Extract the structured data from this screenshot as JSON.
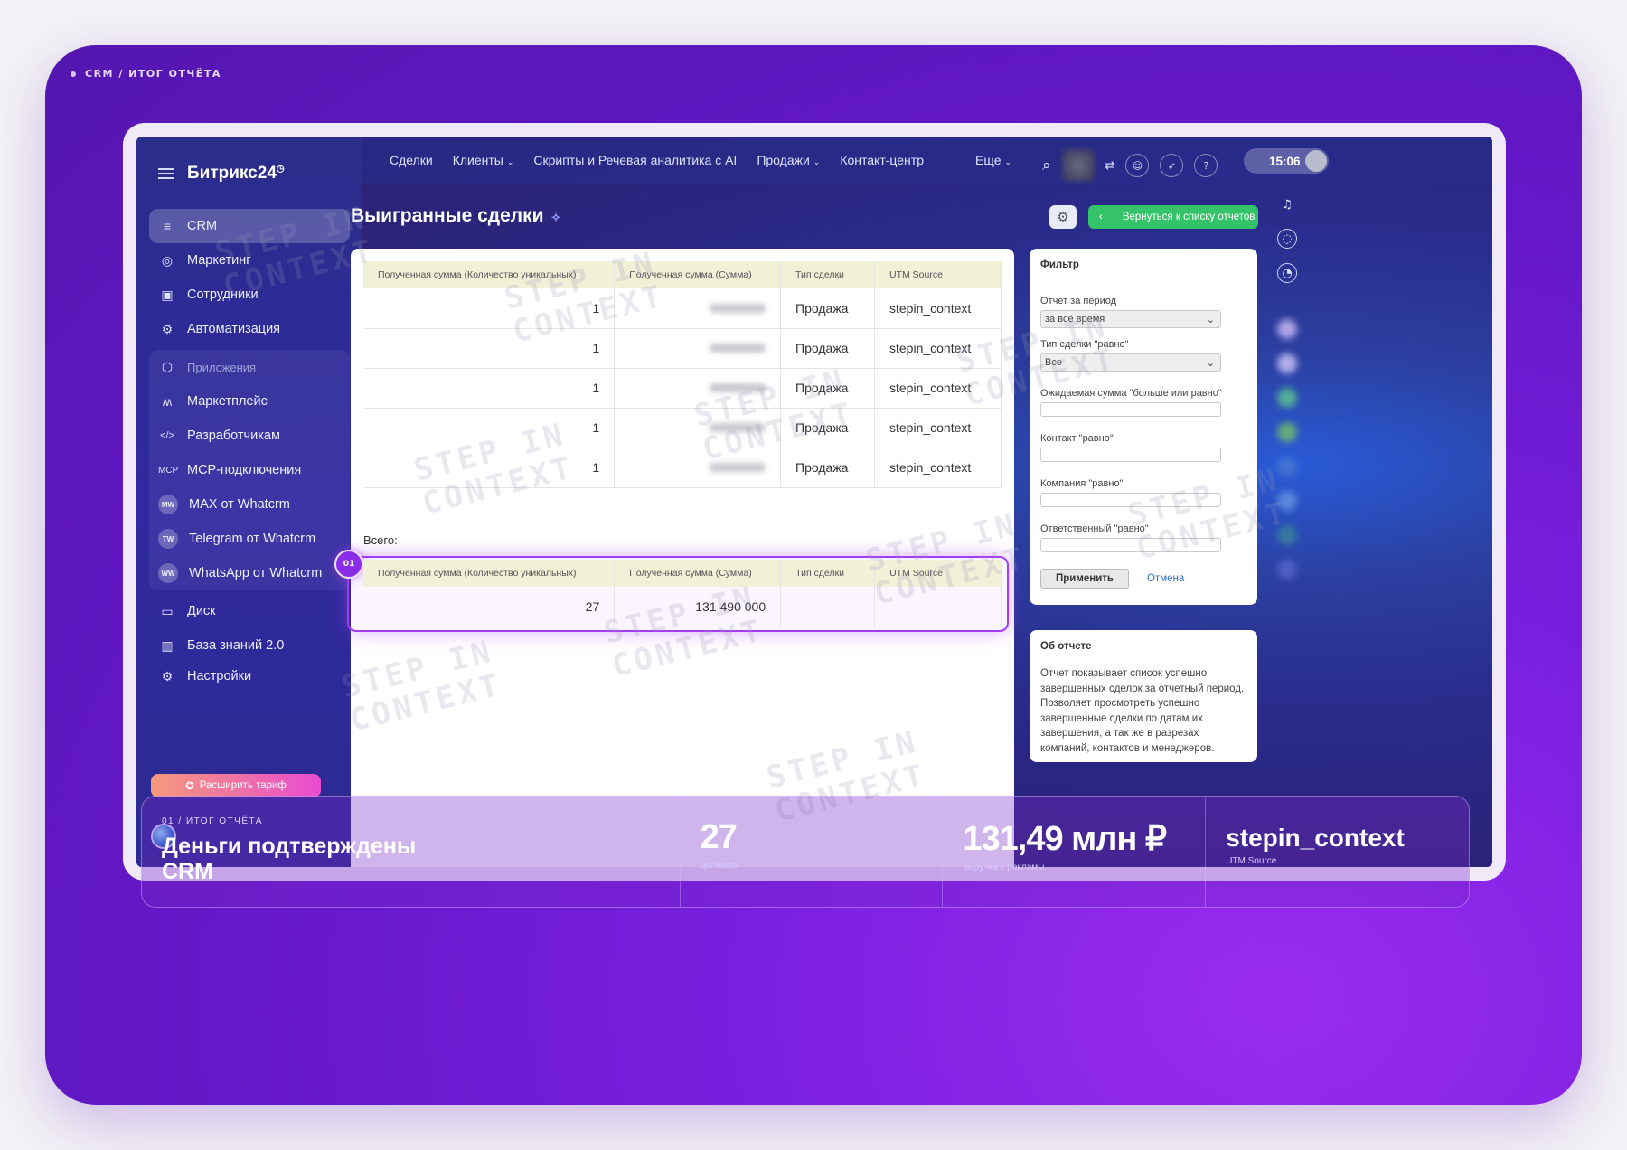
{
  "breadcrumb": "CRM / ИТОГ ОТЧЁТА",
  "app": {
    "logo": "Битрикс24",
    "logo_mark": "◷",
    "sidebar": [
      {
        "label": "CRM",
        "icon": "filter-icon",
        "glyph": "≡"
      },
      {
        "label": "Маркетинг",
        "icon": "target-icon",
        "glyph": "◎"
      },
      {
        "label": "Сотрудники",
        "icon": "id-card-icon",
        "glyph": "▣"
      },
      {
        "label": "Автоматизация",
        "icon": "robot-icon",
        "glyph": "⚙"
      }
    ],
    "apps_group": {
      "title": "Приложения",
      "items": [
        {
          "label": "Маркетплейс",
          "glyph": "ʍ"
        },
        {
          "label": "Разработчикам",
          "glyph": "</>"
        },
        {
          "label": "MCP-подключения",
          "glyph": "MCP"
        },
        {
          "label": "MAX от Whatcrm",
          "badge": "MW"
        },
        {
          "label": "Telegram от Whatcrm",
          "badge": "TW"
        },
        {
          "label": "WhatsApp от Whatcrm",
          "badge": "WW"
        }
      ]
    },
    "sidebar_bottom": [
      {
        "label": "Диск",
        "glyph": "▭"
      },
      {
        "label": "База знаний 2.0",
        "glyph": "▥"
      },
      {
        "label": "Настройки",
        "glyph": "⚙"
      }
    ],
    "upgrade": "Расширить тариф",
    "nav": [
      "Сделки",
      "Клиенты",
      "Скрипты и Речевая аналитика с AI",
      "Продажи",
      "Контакт-центр"
    ],
    "more": "Еще",
    "time": "15:06",
    "page_title": "Выигранные сделки",
    "back_button": "Вернуться к списку отчетов",
    "table": {
      "headers": [
        "Полученная сумма (Количество уникальных)",
        "Полученная сумма (Сумма)",
        "Тип сделки",
        "UTM Source"
      ],
      "rows": [
        [
          "1",
          "",
          "Продажа",
          "stepin_context"
        ],
        [
          "1",
          "",
          "Продажа",
          "stepin_context"
        ],
        [
          "1",
          "",
          "Продажа",
          "stepin_context"
        ],
        [
          "1",
          "",
          "Продажа",
          "stepin_context"
        ],
        [
          "1",
          "",
          "Продажа",
          "stepin_context"
        ]
      ]
    },
    "total_label": "Всего:",
    "total": {
      "headers": [
        "Полученная сумма (Количество уникальных)",
        "Полученная сумма (Сумма)",
        "Тип сделки",
        "UTM Source"
      ],
      "values": [
        "27",
        "131 490 000",
        "—",
        "—"
      ]
    },
    "marker": "01",
    "filter": {
      "title": "Фильтр",
      "period_label": "Отчет за период",
      "period_value": "за все время",
      "type_label": "Тип сделки \"равно\"",
      "type_value": "Все",
      "expected_label": "Ожидаемая сумма \"больше или равно\"",
      "contact_label": "Контакт \"равно\"",
      "company_label": "Компания \"равно\"",
      "responsible_label": "Ответственный \"равно\"",
      "apply": "Применить",
      "cancel": "Отмена"
    },
    "about": {
      "title": "Об отчете",
      "text": "Отчет показывает список успешно завершенных сделок за отчетный период. Позволяет просмотреть успешно завершенные сделки по датам их завершения, а так же в разрезах компаний, контактов и менеджеров."
    },
    "watermark": "STEP IN\nCONTEXT"
  },
  "stats": {
    "kicker": "01 / ИТОГ ОТЧЁТА",
    "headline": "Деньги подтверждены CRM",
    "deals_value": "27",
    "deals_label": "договора",
    "revenue_value": "131,49 млн ₽",
    "revenue_label": "выручка с рекламы",
    "source_value": "stepin_context",
    "source_label": "UTM Source"
  },
  "colors": {
    "accent": "#8b2de8",
    "back_button": "#35c36a",
    "frame": "#6a1ad0"
  }
}
